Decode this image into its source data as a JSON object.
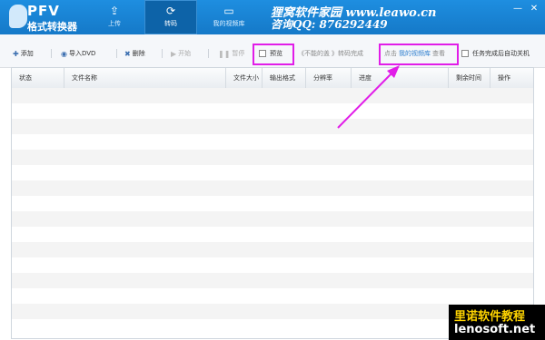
{
  "app": {
    "logo_text": "PFV",
    "title": "格式转换器"
  },
  "nav": {
    "tabs": [
      {
        "label": "上传",
        "icon": "upload-icon"
      },
      {
        "label": "转码",
        "icon": "convert-icon",
        "active": true
      },
      {
        "label": "我的视频库",
        "icon": "video-library-icon"
      }
    ]
  },
  "watermark": {
    "line1": "狸窝软件家园 www.leawo.cn",
    "line2": "咨询QQ: 876292449"
  },
  "window_controls": [
    "minimize",
    "close"
  ],
  "toolbar": {
    "add": "添加",
    "import_dvd": "导入DVD",
    "delete": "删除",
    "start": "开始",
    "pause": "暂停",
    "preview": "预览",
    "ticker_prefix": "《不能的盖",
    "ticker_mid": "》转码完成",
    "click": "点击",
    "library_link": "我的视频库",
    "view": "查看",
    "auto_shutdown": "任务完成后自动关机"
  },
  "table": {
    "columns": [
      "状态",
      "文件名称",
      "文件大小",
      "输出格式",
      "分辨率",
      "进度",
      "剩余时间",
      "操作"
    ],
    "rows": []
  },
  "corner_badge": {
    "line1": "里诺软件教程",
    "line2": "lenosoft.net"
  },
  "colors": {
    "header_blue": "#1b86d8",
    "highlight_magenta": "#e11de8",
    "link_blue": "#2f7fcf"
  }
}
